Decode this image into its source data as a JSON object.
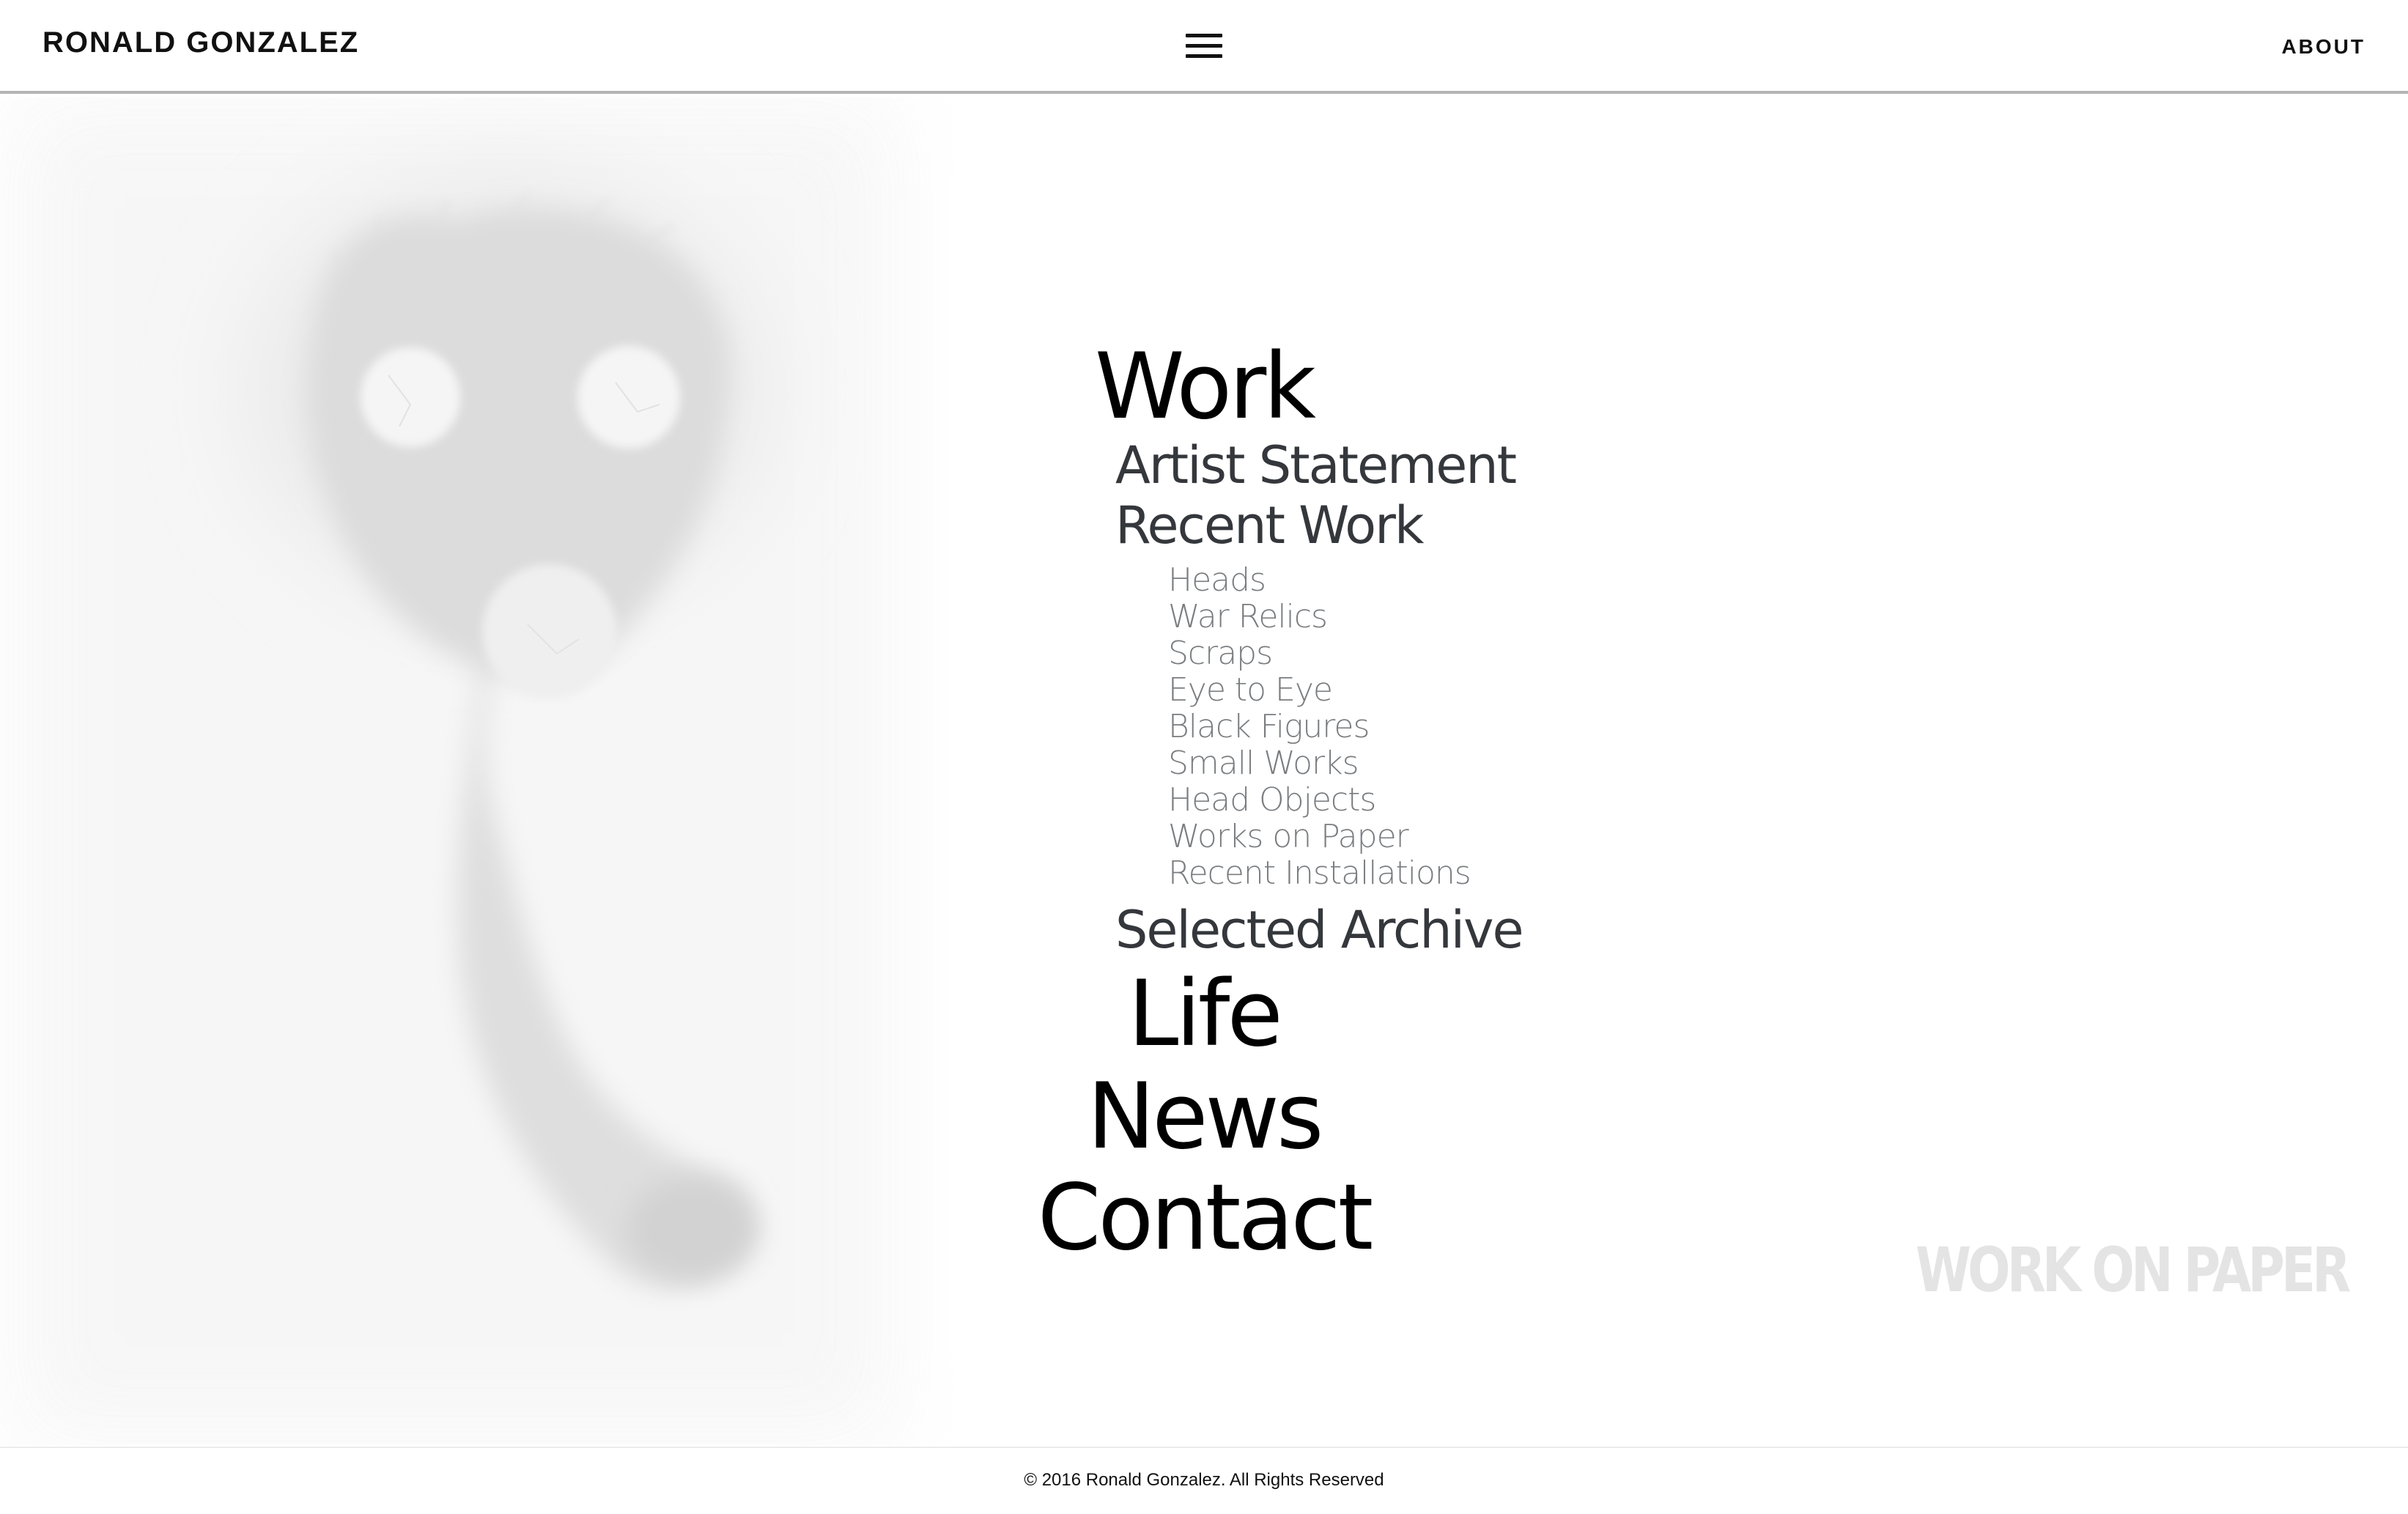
{
  "header": {
    "site_title": "RONALD GONZALEZ",
    "menu_icon": "hamburger-menu-icon",
    "about_label": "ABOUT"
  },
  "nav": {
    "work": "Work",
    "artist_statement": "Artist Statement",
    "recent_work": "Recent Work",
    "recent_work_items": [
      "Heads",
      "War Relics",
      "Scraps",
      "Eye to Eye",
      "Black Figures",
      "Small Works",
      "Head Objects",
      "Works on Paper",
      "Recent Installations"
    ],
    "selected_archive": "Selected Archive",
    "life": "Life",
    "news": "News",
    "contact": "Contact"
  },
  "feature_label": "WORK ON PAPER",
  "footer": {
    "copyright": "© 2016 Ronald Gonzalez. All Rights Reserved"
  },
  "colors": {
    "primary_text": "#000000",
    "secondary_text": "#34373b",
    "tertiary_text": "#7a7d80",
    "watermark": "#e4e4e4",
    "background": "#ffffff"
  }
}
